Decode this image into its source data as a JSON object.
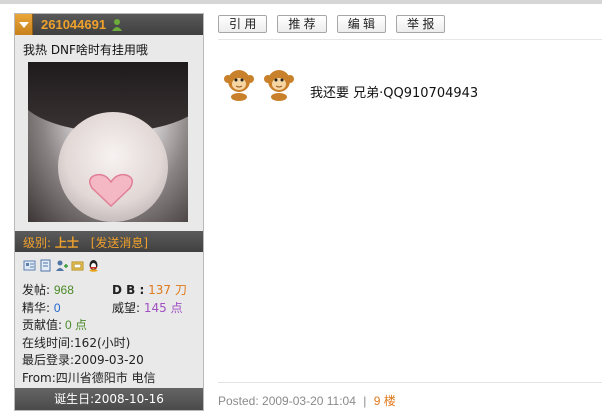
{
  "profile": {
    "username": "261044691",
    "signature": "我热 DNF啥时有挂用哦",
    "level_label": "级别:",
    "level_value": "上士",
    "send_message": "[发送消息]",
    "icons": [
      "profile-card-icon",
      "note-icon",
      "add-friend-icon",
      "home-icon",
      "qq-penguin-icon"
    ],
    "stats": {
      "posts_label": "发帖:",
      "posts_value": "968",
      "db_label": "D B :",
      "db_value": "137 刀",
      "essence_label": "精华:",
      "essence_value": "0",
      "prestige_label": "威望:",
      "prestige_value": "145 点",
      "contribution_label": "贡献值:",
      "contribution_value": "0 点",
      "online_time": "在线时间:162(小时)",
      "last_login": "最后登录:2009-03-20",
      "from": "From:四川省德阳市 电信"
    },
    "birthday": "诞生日:2008-10-16"
  },
  "toolbar": {
    "quote": "引 用",
    "recommend": "推 荐",
    "edit": "编 辑",
    "report": "举 报"
  },
  "post": {
    "emoticons": [
      "monkey-emoticon",
      "monkey-emoticon"
    ],
    "text": "我还要 兄弟·QQ910704943"
  },
  "footer": {
    "posted": "Posted: 2009-03-20 11:04",
    "separator": "|",
    "floor": "9 楼"
  },
  "colors": {
    "accent_orange": "#f0a12c",
    "header_dark": "#4a4a4a",
    "panel_bg": "#e9e9e9"
  }
}
